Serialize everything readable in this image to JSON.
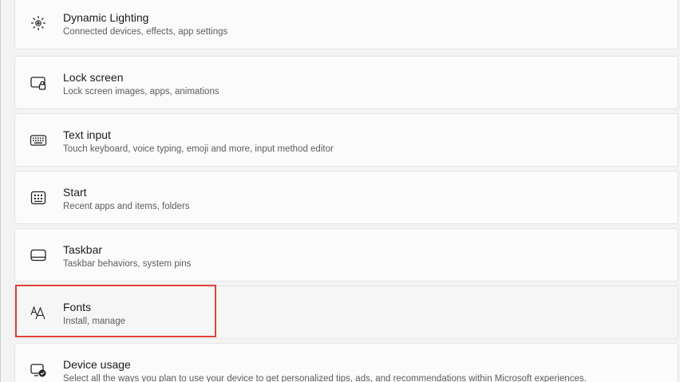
{
  "settings_items": [
    {
      "icon": "dynamic-lighting-icon",
      "title": "Dynamic Lighting",
      "subtitle": "Connected devices, effects, app settings"
    },
    {
      "icon": "lock-screen-icon",
      "title": "Lock screen",
      "subtitle": "Lock screen images, apps, animations"
    },
    {
      "icon": "keyboard-icon",
      "title": "Text input",
      "subtitle": "Touch keyboard, voice typing, emoji and more, input method editor"
    },
    {
      "icon": "start-menu-icon",
      "title": "Start",
      "subtitle": "Recent apps and items, folders"
    },
    {
      "icon": "taskbar-icon",
      "title": "Taskbar",
      "subtitle": "Taskbar behaviors, system pins"
    },
    {
      "icon": "fonts-icon",
      "title": "Fonts",
      "subtitle": "Install, manage"
    },
    {
      "icon": "device-usage-icon",
      "title": "Device usage",
      "subtitle": "Select all the ways you plan to use your device to get personalized tips, ads, and recommendations within Microsoft experiences."
    }
  ],
  "highlight_color": "#e0433b"
}
